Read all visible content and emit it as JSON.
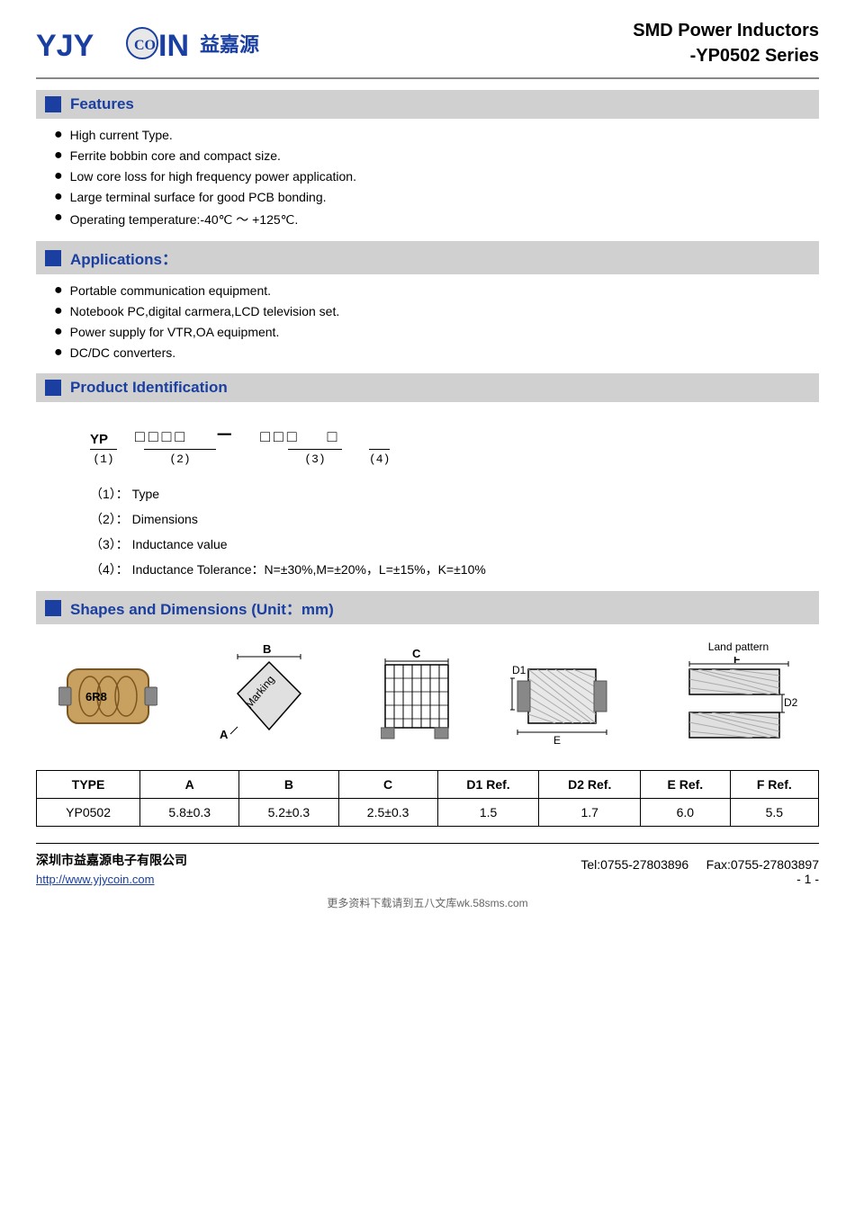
{
  "header": {
    "logo_text": "YJYCOIN",
    "logo_chinese": "益嘉源",
    "title_line1": "SMD Power Inductors",
    "title_line2": "-YP0502 Series"
  },
  "features": {
    "heading": "Features",
    "items": [
      "High current Type.",
      "Ferrite bobbin core and compact size.",
      "Low core loss for high frequency power application.",
      "Large terminal surface for good PCB bonding.",
      "Operating temperature:-40℃ ～ +125℃."
    ]
  },
  "applications": {
    "heading": "Applications：",
    "items": [
      "Portable communication equipment.",
      "Notebook PC,digital carmera,LCD television set.",
      "Power supply for VTR,OA equipment.",
      "DC/DC converters."
    ]
  },
  "product_id": {
    "heading": "Product Identification",
    "part1_label": "YP",
    "part1_number": "(1)",
    "part2_boxes": "□□□□",
    "part2_number": "(2)",
    "part3_boxes": "□□□",
    "part3_number": "(3)",
    "part4_box": "□",
    "part4_number": "(4)",
    "descriptions": [
      "（1）：  Type",
      "（2）：  Dimensions",
      "（3）：  Inductance value",
      "（4）：  Inductance Tolerance：N=±30%,M=±20%，L=±15%，K=±10%"
    ]
  },
  "shapes": {
    "heading": "Shapes and Dimensions (Unit：mm)",
    "land_pattern_label": "Land pattern",
    "labels": {
      "B": "B",
      "C": "C",
      "A": "A",
      "D1": "D1",
      "E": "E",
      "F": "F",
      "D2": "D2",
      "marking": "Marking"
    },
    "table": {
      "headers": [
        "TYPE",
        "A",
        "B",
        "C",
        "D1 Ref.",
        "D2 Ref.",
        "E Ref.",
        "F Ref."
      ],
      "rows": [
        [
          "YP0502",
          "5.8±0.3",
          "5.2±0.3",
          "2.5±0.3",
          "1.5",
          "1.7",
          "6.0",
          "5.5"
        ]
      ]
    }
  },
  "footer": {
    "company": "深圳市益嘉源电子有限公司",
    "tel": "Tel:0755-27803896",
    "fax": "Fax:0755-27803897",
    "website": "http://www.yjycoin.com",
    "page": "- 1 -",
    "bottom_note": "更多资料下载请到五八文库wk.58sms.com"
  }
}
